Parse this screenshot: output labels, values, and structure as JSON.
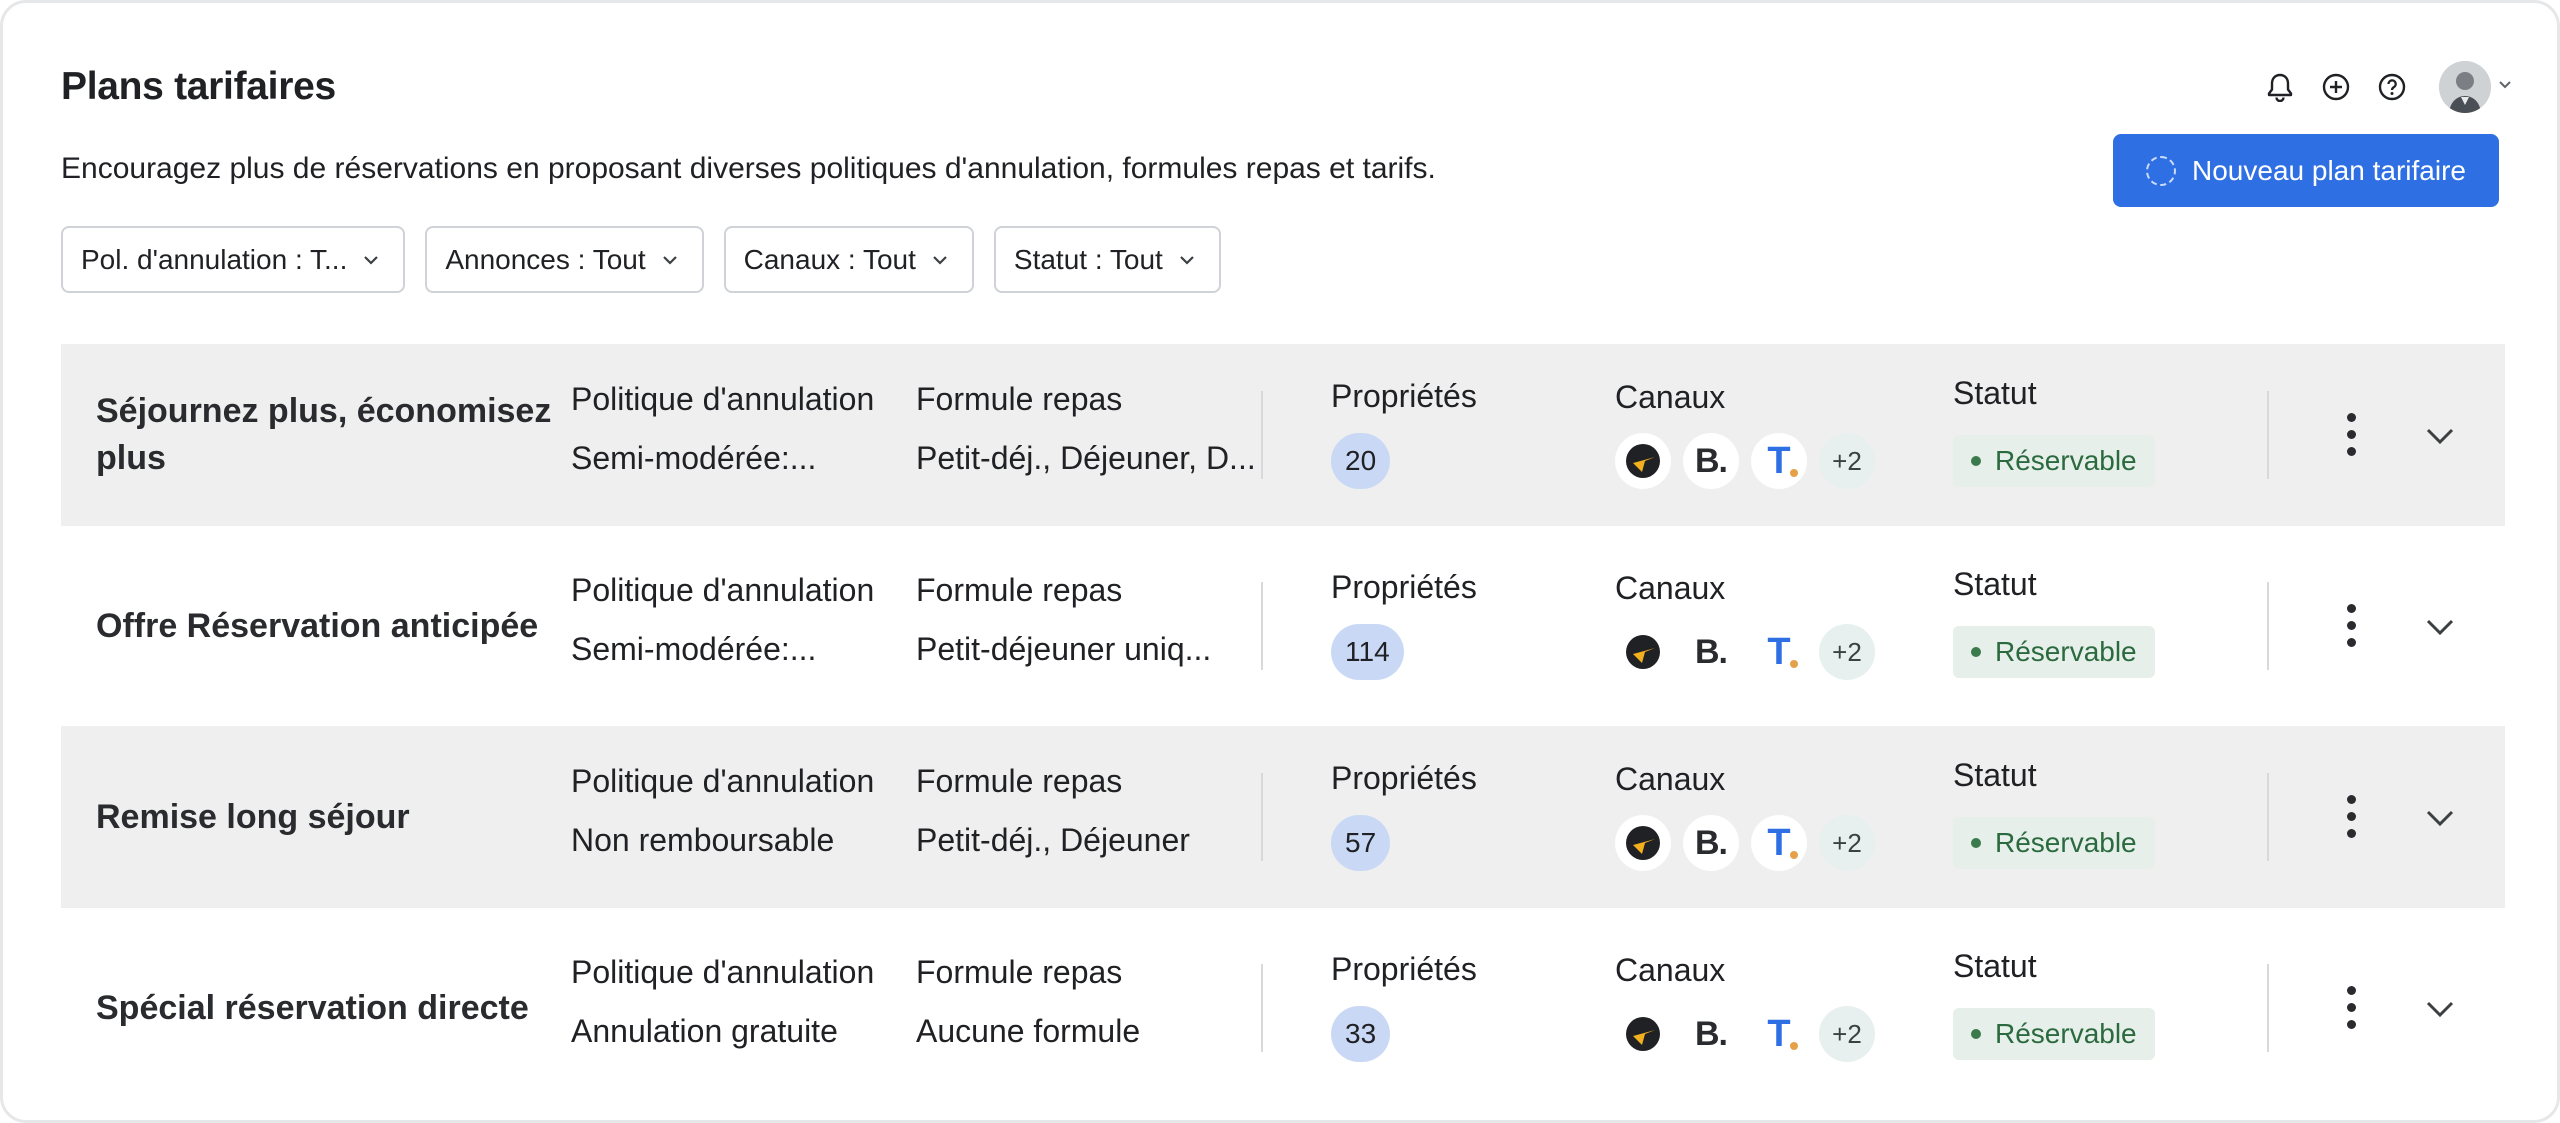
{
  "header": {
    "title": "Plans tarifaires",
    "subtitle": "Encouragez plus de réservations en proposant diverses politiques d'annulation, formules repas et tarifs.",
    "new_button_label": "Nouveau plan tarifaire",
    "icons": [
      "bell-icon",
      "add-circle-icon",
      "help-icon",
      "avatar",
      "chevron-down-icon"
    ]
  },
  "filters": [
    {
      "label": "Pol. d'annulation : T..."
    },
    {
      "label": "Annonces : Tout"
    },
    {
      "label": "Canaux : Tout"
    },
    {
      "label": "Statut : Tout"
    }
  ],
  "columns": {
    "policy": "Politique d'annulation",
    "meal": "Formule repas",
    "properties": "Propriétés",
    "channels": "Canaux",
    "status": "Statut"
  },
  "plans": [
    {
      "name": "Séjournez plus, économisez plus",
      "policy": "Semi-modérée:...",
      "meal": "Petit-déj., Déjeuner, D...",
      "properties": "20",
      "channel_extra": "+2",
      "status": "Réservable"
    },
    {
      "name": "Offre Réservation anticipée",
      "policy": "Semi-modérée:...",
      "meal": "Petit-déjeuner uniq...",
      "properties": "114",
      "channel_extra": "+2",
      "status": "Réservable"
    },
    {
      "name": "Remise long séjour",
      "policy": "Non remboursable",
      "meal": "Petit-déj., Déjeuner",
      "properties": "57",
      "channel_extra": "+2",
      "status": "Réservable"
    },
    {
      "name": "Spécial réservation directe",
      "policy": "Annulation gratuite",
      "meal": "Aucune formule",
      "properties": "33",
      "channel_extra": "+2",
      "status": "Réservable"
    }
  ],
  "channel_logos": {
    "first": "compass-logo-icon",
    "second_text": "B.",
    "third_text": "T"
  },
  "colors": {
    "accent": "#2f6fe4",
    "status_bg": "#e6efe9",
    "status_text": "#2b6a3f",
    "pill_bg": "#c9d9f5",
    "row_shade": "#efefef"
  }
}
